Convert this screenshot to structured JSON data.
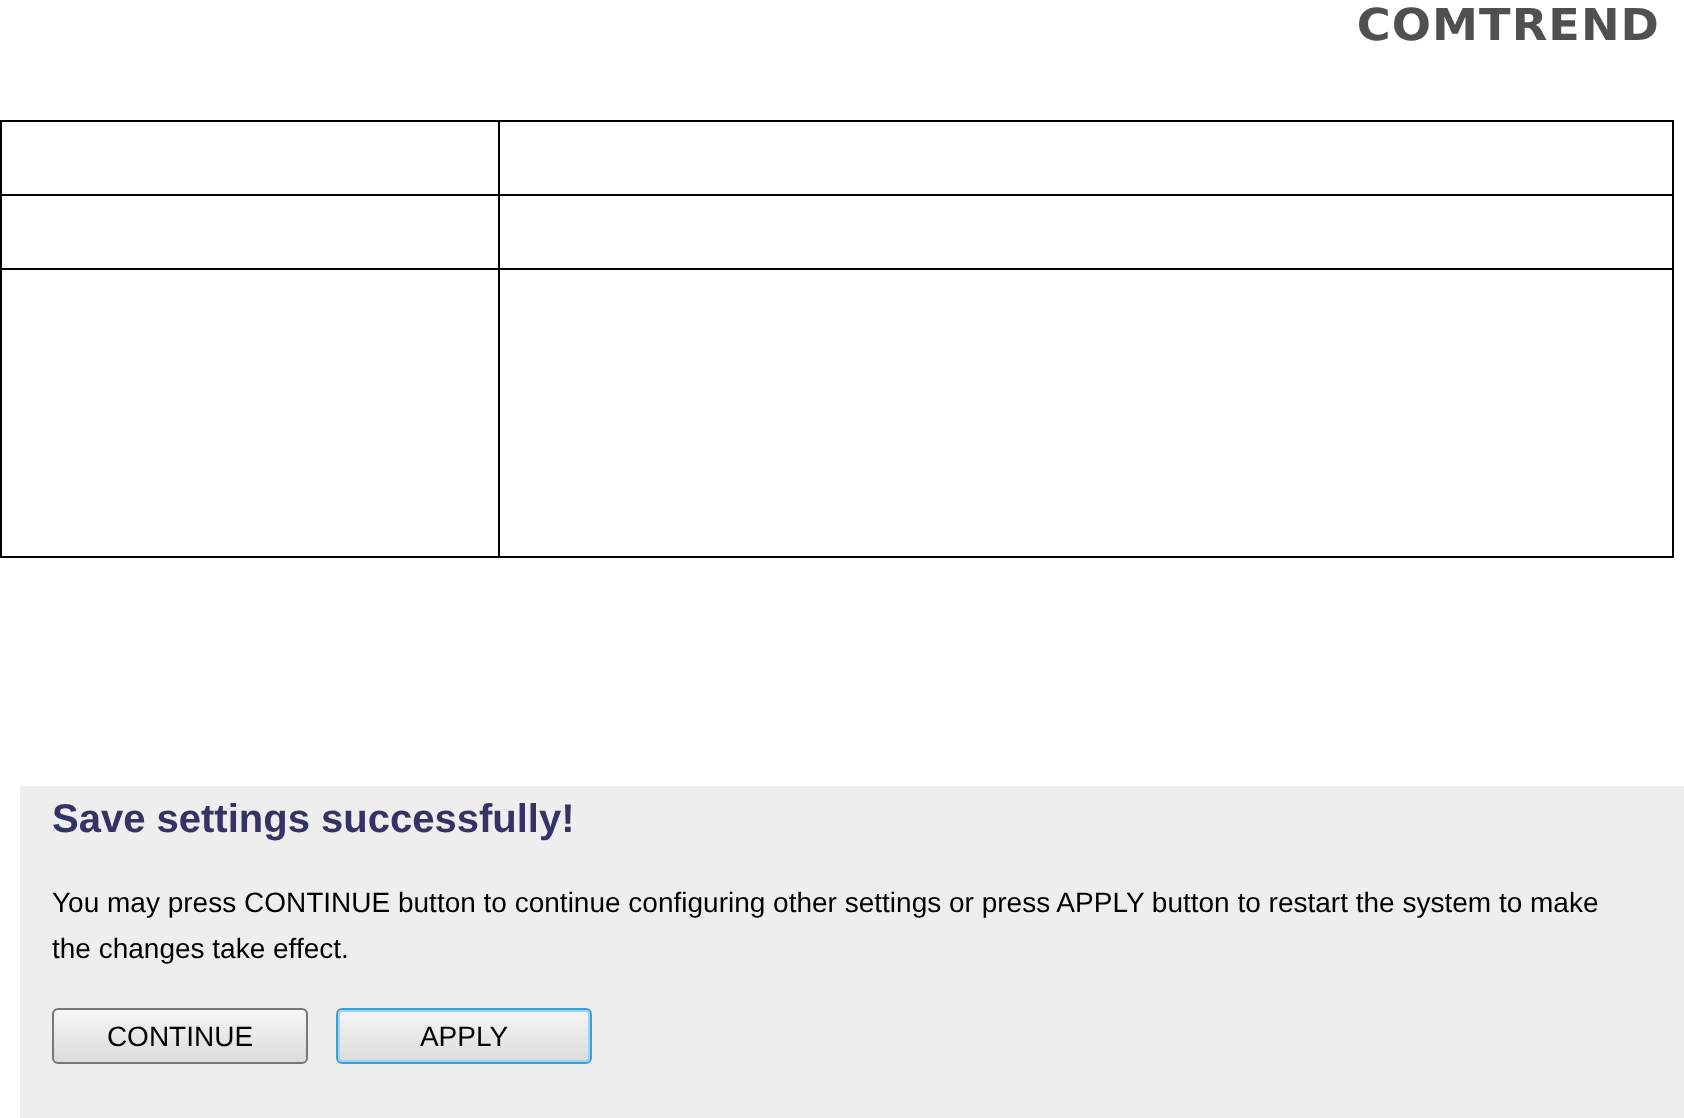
{
  "logo": {
    "text": "COMTREND"
  },
  "panel": {
    "title": "Save settings successfully!",
    "message": "You may press CONTINUE button to continue configuring other settings or press APPLY button to restart the system to make the changes take effect.",
    "buttons": [
      {
        "label": "CONTINUE",
        "focused": false
      },
      {
        "label": "APPLY",
        "focused": true
      }
    ]
  }
}
